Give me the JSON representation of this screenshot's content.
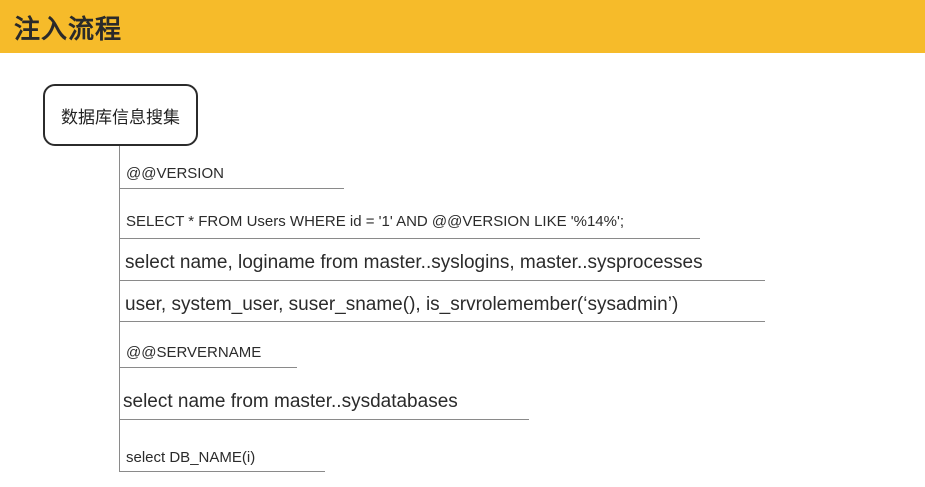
{
  "header": {
    "title": "注入流程"
  },
  "root": {
    "label": "数据库信息搜集"
  },
  "branches": [
    "@@VERSION",
    "SELECT * FROM Users WHERE id = '1' AND @@VERSION LIKE '%14%';",
    "select name, loginame from master..syslogins, master..sysprocesses",
    "user, system_user, suser_sname(), is_srvrolemember(‘sysadmin’)",
    "@@SERVERNAME",
    "select name from master..sysdatabases",
    "select DB_NAME(i)"
  ],
  "colors": {
    "header_bg": "#f6bb2a",
    "line": "#8a8a8a",
    "text": "#2b2b2b"
  }
}
